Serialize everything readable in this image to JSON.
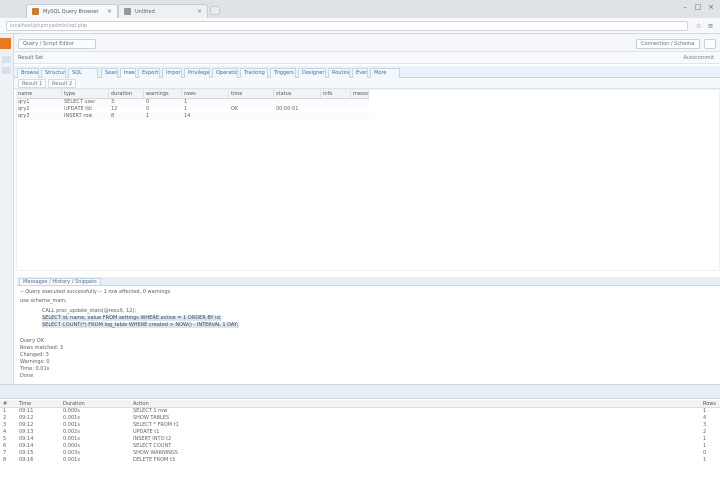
{
  "browser": {
    "tabs": [
      {
        "label": "MySQL Query Browser",
        "active": true
      },
      {
        "label": "Untitled",
        "active": false
      }
    ],
    "address": "localhost/phpmyadmin/sql.php",
    "icons": [
      "star-icon",
      "menu-icon"
    ]
  },
  "app": {
    "header_left": "Query / Script Editor",
    "header_right": "Connection / Schema",
    "breadcrumb": "Result Set",
    "breadcrumb_right": "Autocommit",
    "tabs": [
      "Browse",
      "Structure",
      "SQL",
      "Search",
      "Insert",
      "Export",
      "Import",
      "Privileges",
      "Operations",
      "Tracking",
      "Triggers",
      "Designer",
      "Routines",
      "Events",
      "More"
    ],
    "active_tab": 4,
    "subtabs": [
      "Result 1",
      "Result 2"
    ]
  },
  "grid": {
    "columns": [
      "name",
      "type",
      "duration",
      "warnings",
      "rows",
      "time",
      "status",
      "info",
      "message"
    ],
    "rows": [
      [
        "qry1",
        "SELECT user",
        "3",
        "0",
        "1",
        "",
        "",
        "",
        ""
      ],
      [
        "qry2",
        "UPDATE tbl",
        "12",
        "0",
        "1",
        "OK",
        "00:00:01",
        "",
        ""
      ],
      [
        "qry3",
        "INSERT row",
        "8",
        "1",
        "14",
        "",
        "",
        "",
        ""
      ]
    ]
  },
  "messages": {
    "tab_label": "Messages / History / Snippets",
    "lines": [
      "-- Query executed successfully --  1 row affected, 0 warnings",
      "use schema_main;",
      "CALL proc_update_stats(@result, 12);",
      "SELECT id, name, value FROM settings WHERE active = 1 ORDER BY id;",
      "SELECT COUNT(*) FROM log_table WHERE created > NOW() - INTERVAL 1 DAY;",
      "Query OK",
      "Rows matched: 3",
      "Changed: 3",
      "Warnings: 0",
      "Time: 0.01s",
      "Done"
    ]
  },
  "log": {
    "columns": [
      "#",
      "Time",
      "Duration",
      "Action",
      "Rows"
    ],
    "rows": [
      [
        "1",
        "09:11",
        "0.000s",
        "SELECT 1 row",
        "1"
      ],
      [
        "2",
        "09:12",
        "0.001s",
        "SHOW TABLES",
        "4"
      ],
      [
        "3",
        "09:12",
        "0.001s",
        "SELECT * FROM t1",
        "3"
      ],
      [
        "4",
        "09:13",
        "0.002s",
        "UPDATE t1",
        "2"
      ],
      [
        "5",
        "09:14",
        "0.001s",
        "INSERT INTO t2",
        "1"
      ],
      [
        "6",
        "09:14",
        "0.000s",
        "SELECT COUNT",
        "1"
      ],
      [
        "7",
        "09:15",
        "0.003s",
        "SHOW WARNINGS",
        "0"
      ],
      [
        "8",
        "09:16",
        "0.001s",
        "DELETE FROM t3",
        "1"
      ]
    ]
  }
}
